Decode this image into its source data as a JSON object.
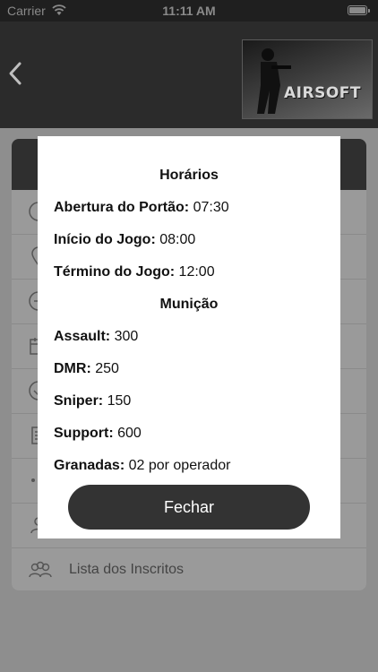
{
  "status_bar": {
    "carrier": "Carrier",
    "time": "11:11 AM"
  },
  "nav": {
    "logo_text": "AIRSOFT"
  },
  "background_list": {
    "last_item_label": "Lista dos Inscritos"
  },
  "modal": {
    "horarios_title": "Horários",
    "abertura": {
      "label": "Abertura do Portão:",
      "value": " 07:30"
    },
    "inicio": {
      "label": "Início do Jogo:",
      "value": " 08:00"
    },
    "termino": {
      "label": "Término do Jogo:",
      "value": " 12:00"
    },
    "municao_title": "Munição",
    "assault": {
      "label": "Assault:",
      "value": " 300"
    },
    "dmr": {
      "label": "DMR:",
      "value": " 250"
    },
    "sniper": {
      "label": "Sniper:",
      "value": " 150"
    },
    "support": {
      "label": "Support:",
      "value": " 600"
    },
    "granadas": {
      "label": "Granadas:",
      "value": " 02 por operador"
    },
    "close_label": "Fechar"
  },
  "colors": {
    "nav_background": "#2b2b2b",
    "overlay": "#8e8e8e",
    "button": "#333333"
  }
}
